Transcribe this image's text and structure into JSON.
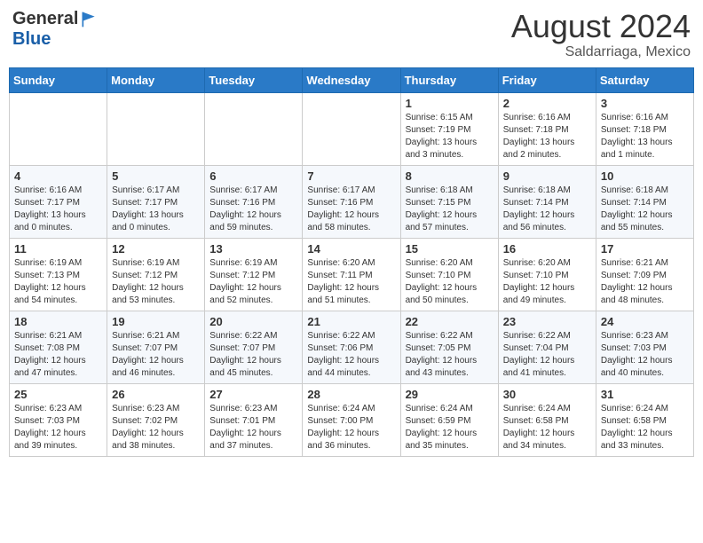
{
  "header": {
    "logo_general": "General",
    "logo_blue": "Blue",
    "month_year": "August 2024",
    "location": "Saldarriaga, Mexico"
  },
  "weekdays": [
    "Sunday",
    "Monday",
    "Tuesday",
    "Wednesday",
    "Thursday",
    "Friday",
    "Saturday"
  ],
  "weeks": [
    [
      {
        "day": "",
        "info": ""
      },
      {
        "day": "",
        "info": ""
      },
      {
        "day": "",
        "info": ""
      },
      {
        "day": "",
        "info": ""
      },
      {
        "day": "1",
        "info": "Sunrise: 6:15 AM\nSunset: 7:19 PM\nDaylight: 13 hours\nand 3 minutes."
      },
      {
        "day": "2",
        "info": "Sunrise: 6:16 AM\nSunset: 7:18 PM\nDaylight: 13 hours\nand 2 minutes."
      },
      {
        "day": "3",
        "info": "Sunrise: 6:16 AM\nSunset: 7:18 PM\nDaylight: 13 hours\nand 1 minute."
      }
    ],
    [
      {
        "day": "4",
        "info": "Sunrise: 6:16 AM\nSunset: 7:17 PM\nDaylight: 13 hours\nand 0 minutes."
      },
      {
        "day": "5",
        "info": "Sunrise: 6:17 AM\nSunset: 7:17 PM\nDaylight: 13 hours\nand 0 minutes."
      },
      {
        "day": "6",
        "info": "Sunrise: 6:17 AM\nSunset: 7:16 PM\nDaylight: 12 hours\nand 59 minutes."
      },
      {
        "day": "7",
        "info": "Sunrise: 6:17 AM\nSunset: 7:16 PM\nDaylight: 12 hours\nand 58 minutes."
      },
      {
        "day": "8",
        "info": "Sunrise: 6:18 AM\nSunset: 7:15 PM\nDaylight: 12 hours\nand 57 minutes."
      },
      {
        "day": "9",
        "info": "Sunrise: 6:18 AM\nSunset: 7:14 PM\nDaylight: 12 hours\nand 56 minutes."
      },
      {
        "day": "10",
        "info": "Sunrise: 6:18 AM\nSunset: 7:14 PM\nDaylight: 12 hours\nand 55 minutes."
      }
    ],
    [
      {
        "day": "11",
        "info": "Sunrise: 6:19 AM\nSunset: 7:13 PM\nDaylight: 12 hours\nand 54 minutes."
      },
      {
        "day": "12",
        "info": "Sunrise: 6:19 AM\nSunset: 7:12 PM\nDaylight: 12 hours\nand 53 minutes."
      },
      {
        "day": "13",
        "info": "Sunrise: 6:19 AM\nSunset: 7:12 PM\nDaylight: 12 hours\nand 52 minutes."
      },
      {
        "day": "14",
        "info": "Sunrise: 6:20 AM\nSunset: 7:11 PM\nDaylight: 12 hours\nand 51 minutes."
      },
      {
        "day": "15",
        "info": "Sunrise: 6:20 AM\nSunset: 7:10 PM\nDaylight: 12 hours\nand 50 minutes."
      },
      {
        "day": "16",
        "info": "Sunrise: 6:20 AM\nSunset: 7:10 PM\nDaylight: 12 hours\nand 49 minutes."
      },
      {
        "day": "17",
        "info": "Sunrise: 6:21 AM\nSunset: 7:09 PM\nDaylight: 12 hours\nand 48 minutes."
      }
    ],
    [
      {
        "day": "18",
        "info": "Sunrise: 6:21 AM\nSunset: 7:08 PM\nDaylight: 12 hours\nand 47 minutes."
      },
      {
        "day": "19",
        "info": "Sunrise: 6:21 AM\nSunset: 7:07 PM\nDaylight: 12 hours\nand 46 minutes."
      },
      {
        "day": "20",
        "info": "Sunrise: 6:22 AM\nSunset: 7:07 PM\nDaylight: 12 hours\nand 45 minutes."
      },
      {
        "day": "21",
        "info": "Sunrise: 6:22 AM\nSunset: 7:06 PM\nDaylight: 12 hours\nand 44 minutes."
      },
      {
        "day": "22",
        "info": "Sunrise: 6:22 AM\nSunset: 7:05 PM\nDaylight: 12 hours\nand 43 minutes."
      },
      {
        "day": "23",
        "info": "Sunrise: 6:22 AM\nSunset: 7:04 PM\nDaylight: 12 hours\nand 41 minutes."
      },
      {
        "day": "24",
        "info": "Sunrise: 6:23 AM\nSunset: 7:03 PM\nDaylight: 12 hours\nand 40 minutes."
      }
    ],
    [
      {
        "day": "25",
        "info": "Sunrise: 6:23 AM\nSunset: 7:03 PM\nDaylight: 12 hours\nand 39 minutes."
      },
      {
        "day": "26",
        "info": "Sunrise: 6:23 AM\nSunset: 7:02 PM\nDaylight: 12 hours\nand 38 minutes."
      },
      {
        "day": "27",
        "info": "Sunrise: 6:23 AM\nSunset: 7:01 PM\nDaylight: 12 hours\nand 37 minutes."
      },
      {
        "day": "28",
        "info": "Sunrise: 6:24 AM\nSunset: 7:00 PM\nDaylight: 12 hours\nand 36 minutes."
      },
      {
        "day": "29",
        "info": "Sunrise: 6:24 AM\nSunset: 6:59 PM\nDaylight: 12 hours\nand 35 minutes."
      },
      {
        "day": "30",
        "info": "Sunrise: 6:24 AM\nSunset: 6:58 PM\nDaylight: 12 hours\nand 34 minutes."
      },
      {
        "day": "31",
        "info": "Sunrise: 6:24 AM\nSunset: 6:58 PM\nDaylight: 12 hours\nand 33 minutes."
      }
    ]
  ]
}
